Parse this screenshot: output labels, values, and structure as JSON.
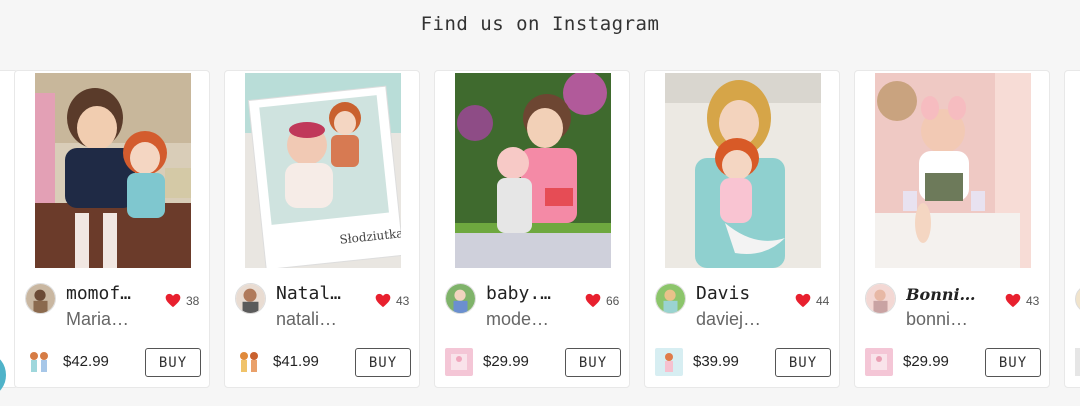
{
  "section": {
    "title": "Find us on Instagram"
  },
  "posts": [
    {
      "user": "momof…",
      "handle": "Maria…",
      "likes": "38",
      "price": "$42.99",
      "buy": "BUY"
    },
    {
      "user": "Natal…",
      "handle": "natali…",
      "likes": "43",
      "price": "$41.99",
      "buy": "BUY"
    },
    {
      "user": "baby.…",
      "handle": "mode…",
      "likes": "66",
      "price": "$29.99",
      "buy": "BUY"
    },
    {
      "user": "Davis",
      "handle": "daviej…",
      "likes": "44",
      "price": "$39.99",
      "buy": "BUY"
    },
    {
      "user": "𝑩𝒐𝒏𝒏𝒊…",
      "handle": "bonni…",
      "likes": "43",
      "price": "$29.99",
      "buy": "BUY"
    }
  ],
  "colors": {
    "heart": "#e8202e",
    "chat": "#4fb3c9",
    "background": "#f6f6f6"
  },
  "icons": {
    "like": "heart-icon"
  }
}
